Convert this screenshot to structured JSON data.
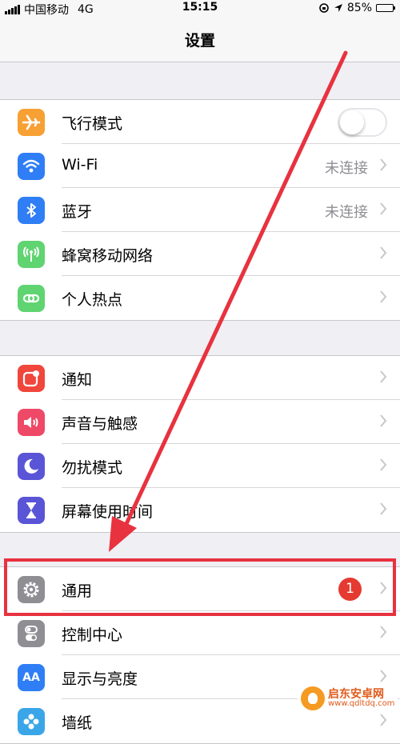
{
  "status_bar": {
    "carrier": "中国移动",
    "network": "4G",
    "time": "15:15",
    "battery": "85%",
    "battery_level": 0.85
  },
  "nav": {
    "title": "设置"
  },
  "colors": {
    "airplane": "#f7a034",
    "wifi": "#2f7ef6",
    "bluetooth": "#2f7ef6",
    "cellular": "#5fd470",
    "hotspot": "#5fd470",
    "notifications": "#f0463c",
    "sounds": "#ee4966",
    "dnd": "#5a55d6",
    "screen_time": "#5a55d6",
    "general": "#8e8e93",
    "control_center": "#8e8e93",
    "display": "#2f7ef6",
    "wallpaper": "#3aa6e8",
    "annotation": "#e8323f"
  },
  "group1": [
    {
      "label": "飞行模式",
      "icon": "airplane-icon",
      "control": "toggle",
      "toggle_on": false
    },
    {
      "label": "Wi-Fi",
      "icon": "wifi-icon",
      "value": "未连接"
    },
    {
      "label": "蓝牙",
      "icon": "bluetooth-icon",
      "value": "未连接"
    },
    {
      "label": "蜂窝移动网络",
      "icon": "cellular-icon"
    },
    {
      "label": "个人热点",
      "icon": "hotspot-icon"
    }
  ],
  "group2": [
    {
      "label": "通知",
      "icon": "notifications-icon"
    },
    {
      "label": "声音与触感",
      "icon": "speaker-icon"
    },
    {
      "label": "勿扰模式",
      "icon": "moon-icon"
    },
    {
      "label": "屏幕使用时间",
      "icon": "hourglass-icon"
    }
  ],
  "group3": [
    {
      "label": "通用",
      "icon": "gear-icon",
      "badge": "1"
    },
    {
      "label": "控制中心",
      "icon": "toggles-icon"
    },
    {
      "label": "显示与亮度",
      "icon": "text-size-icon",
      "icon_text": "AA"
    },
    {
      "label": "墙纸",
      "icon": "flower-icon"
    }
  ],
  "watermark": {
    "title": "启东安卓网",
    "url": "www.qdltdq.com"
  }
}
